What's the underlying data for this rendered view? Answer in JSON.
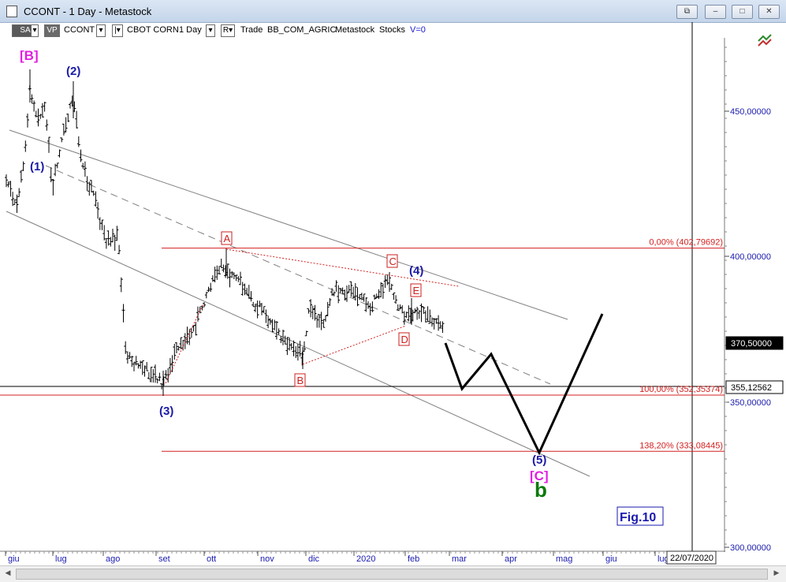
{
  "window": {
    "title": "CCONT - 1 Day - Metastock",
    "buttons": {
      "restore": "⧉",
      "minimize": "–",
      "maximize": "□",
      "close": "✕"
    }
  },
  "toolbar": {
    "sa": "SA",
    "vp": "VP",
    "symbol": "CCONT",
    "security_name": "CBOT CORN",
    "period": "1 Day",
    "r": "R",
    "mode": "Trade",
    "sector": "BB_COM_AGRIC",
    "source": "Metastock",
    "type": "Stocks",
    "v": "V=0"
  },
  "colors": {
    "price_bars": "#000000",
    "channel": "#808080",
    "fib_lines": "#d42020",
    "wave_labels_blue": "#1a1aa6",
    "wave_labels_magenta": "#e020e0",
    "wave_b_green": "#0a7a0a",
    "triangle_labels": "#cc2020"
  },
  "chart_data": {
    "type": "line",
    "title": "",
    "y_ticks": [
      "450,00000",
      "400,00000",
      "350,00000",
      "300,00000"
    ],
    "y_tick_values": [
      450,
      400,
      350,
      300
    ],
    "ylim": [
      296.5,
      484
    ],
    "x_ticks": [
      "giu",
      "lug",
      "ago",
      "set",
      "ott",
      "nov",
      "dic",
      "2020",
      "feb",
      "mar",
      "apr",
      "mag",
      "giu",
      "lug"
    ],
    "price_badges": [
      {
        "label": "370,50000",
        "value": 370.5,
        "style": "dark"
      },
      {
        "label": "355,12562",
        "value": 355.13,
        "style": "light"
      }
    ],
    "date_badge": "22/07/2020",
    "fib_levels": [
      {
        "label": "0,00% (402,79692)",
        "value": 402.79692
      },
      {
        "label": "100,00% (352,35374)",
        "value": 352.35374
      },
      {
        "label": "138,20% (333,08445)",
        "value": 333.08445
      }
    ],
    "wave_labels": [
      {
        "text": "[B]",
        "color": "magenta"
      },
      {
        "text": "(2)",
        "color": "blue"
      },
      {
        "text": "(1)",
        "color": "blue"
      },
      {
        "text": "(3)",
        "color": "blue"
      },
      {
        "text": "(4)",
        "color": "blue"
      },
      {
        "text": "(5)",
        "color": "blue"
      },
      {
        "text": "[C]",
        "color": "magenta"
      },
      {
        "text": "b",
        "color": "green"
      }
    ],
    "triangle_labels": [
      "A",
      "B",
      "C",
      "D",
      "E"
    ],
    "projection_path_values": [
      373,
      354.5,
      368,
      333.5,
      379
    ],
    "annotation": "Fig.10"
  }
}
